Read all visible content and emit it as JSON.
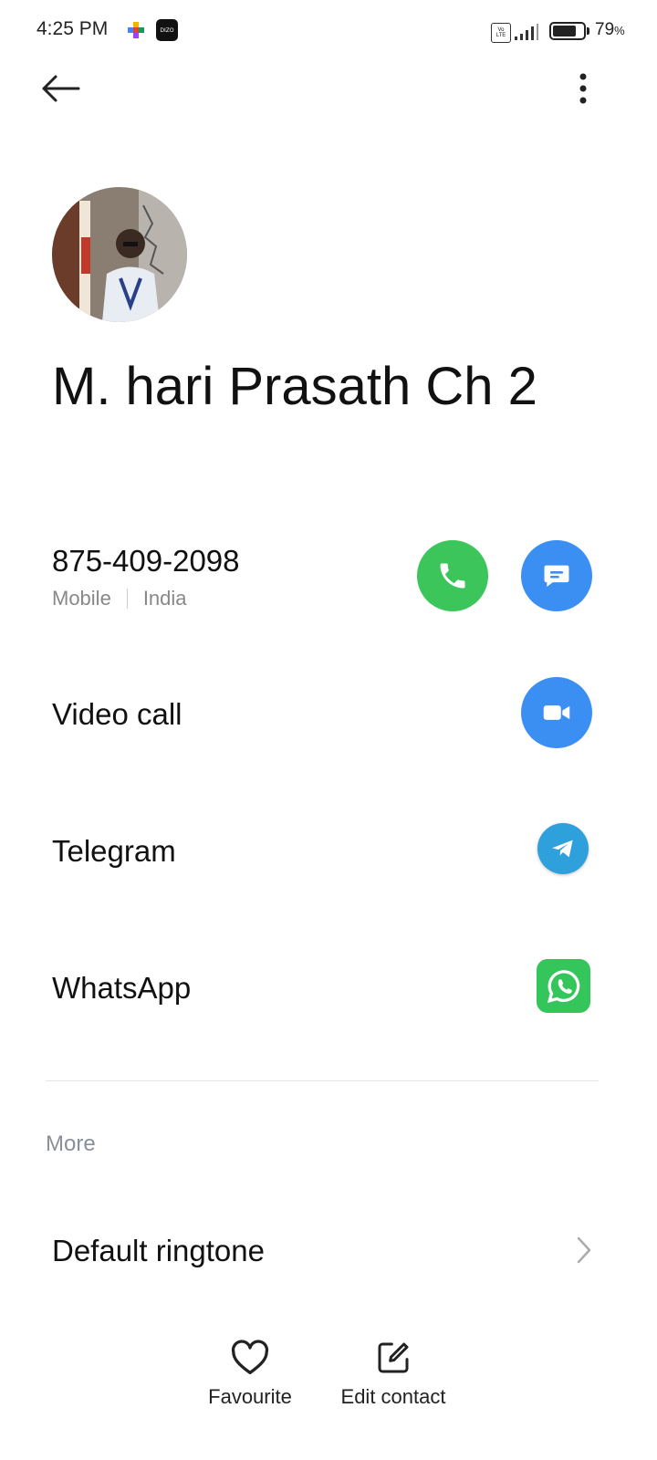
{
  "status_bar": {
    "time": "4:25 PM",
    "app_icons": [
      "google-play-games-icon",
      "dizo-icon"
    ],
    "dizo_text": "DIZO",
    "volte_text": "Vo LTE",
    "battery_percent": "79",
    "battery_unit": "%",
    "battery_level": 0.79
  },
  "top_bar": {
    "back_icon": "arrow-left-icon",
    "more_icon": "more-vertical-icon"
  },
  "contact": {
    "name": "M. hari Prasath Ch 2",
    "phone": {
      "number": "875-409-2098",
      "type": "Mobile",
      "country": "India"
    }
  },
  "actions": [
    {
      "label": "Video call",
      "icon": "video-camera-icon",
      "color": "#3b8ff3"
    },
    {
      "label": "Telegram",
      "icon": "telegram-icon",
      "color": "#2ea0dc"
    },
    {
      "label": "WhatsApp",
      "icon": "whatsapp-icon",
      "color": "#34c65a"
    }
  ],
  "phone_buttons": [
    {
      "icon": "phone-icon",
      "color": "#3cc55a"
    },
    {
      "icon": "message-icon",
      "color": "#3b8ff3"
    }
  ],
  "more_section": {
    "title": "More",
    "items": [
      {
        "label": "Default ringtone",
        "icon": "chevron-right-icon"
      }
    ]
  },
  "bottom_bar": {
    "favourite": "Favourite",
    "edit_contact": "Edit contact"
  }
}
